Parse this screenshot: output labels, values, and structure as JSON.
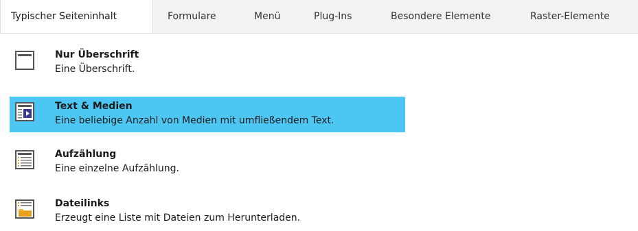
{
  "tabs": [
    {
      "label": "Typischer Seiteninhalt",
      "active": true
    },
    {
      "label": "Formulare",
      "active": false
    },
    {
      "label": "Menü",
      "active": false
    },
    {
      "label": "Plug-Ins",
      "active": false
    },
    {
      "label": "Besondere Elemente",
      "active": false
    },
    {
      "label": "Raster-Elemente",
      "active": false
    }
  ],
  "items": [
    {
      "title": "Nur Überschrift",
      "description": "Eine Überschrift.",
      "icon": "header-only-icon",
      "selected": false
    },
    {
      "title": "Text & Medien",
      "description": "Eine beliebige Anzahl von Medien mit umfließendem Text.",
      "icon": "text-media-icon",
      "selected": true
    },
    {
      "title": "Aufzählung",
      "description": "Eine einzelne Aufzählung.",
      "icon": "bullet-list-icon",
      "selected": false
    },
    {
      "title": "Dateilinks",
      "description": "Erzeugt eine Liste mit Dateien zum Herunterladen.",
      "icon": "file-links-icon",
      "selected": false
    }
  ],
  "colors": {
    "selected_background": "#4cc6f2",
    "tabbar_background": "#f2f2f2"
  }
}
